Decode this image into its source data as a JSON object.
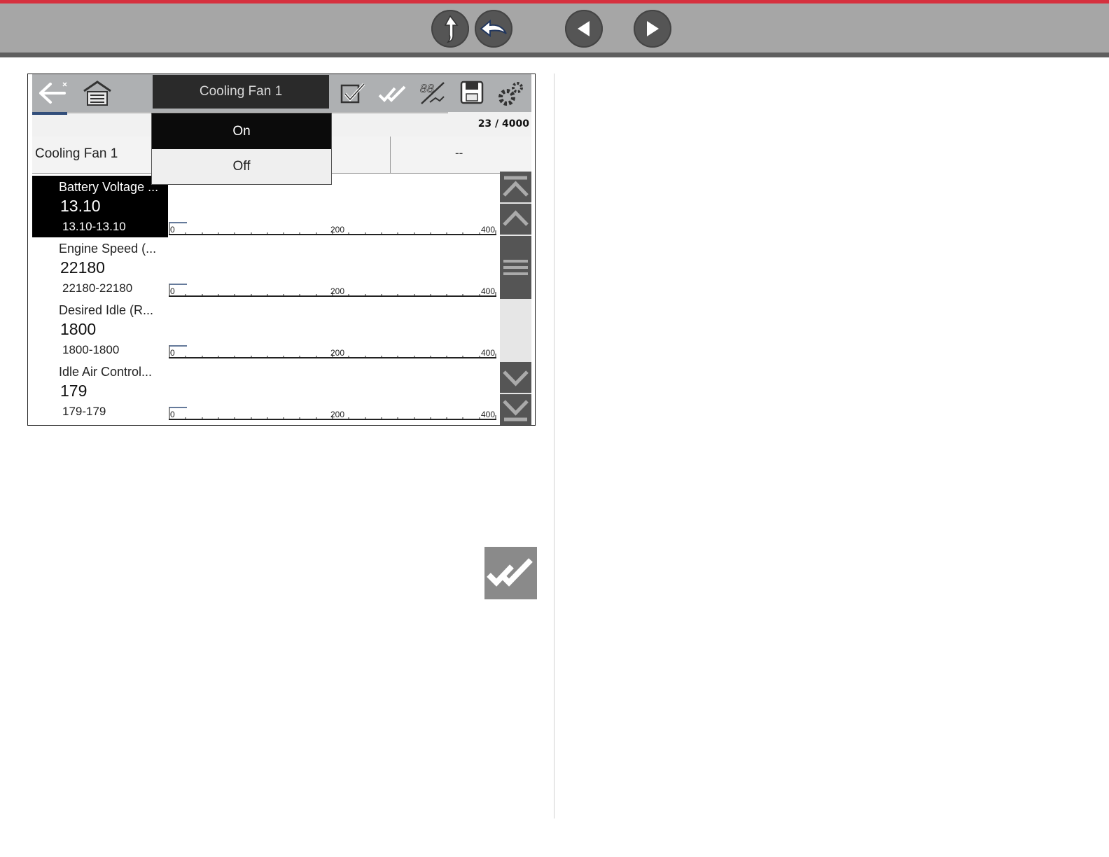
{
  "nav": {
    "buttons": [
      "up-icon",
      "back-arrow-icon",
      "previous-icon",
      "next-icon"
    ]
  },
  "toolbar": {
    "title": "Cooling Fan 1",
    "icons": [
      "back-icon",
      "home-icon",
      "check-icon",
      "check-all-icon",
      "pid-icon",
      "save-icon",
      "settings-icon"
    ]
  },
  "progress": {
    "counter": "23 / 4000",
    "fraction": 0.00575
  },
  "pid": {
    "name": "Cooling Fan 1",
    "value": "--"
  },
  "dropdown": {
    "options": [
      "On",
      "Off"
    ],
    "selected": "On"
  },
  "data_list": [
    {
      "name": "Battery Voltage ...",
      "value": "13.10",
      "range": "13.10-13.10",
      "selected": true
    },
    {
      "name": "Engine Speed (...",
      "value": "22180",
      "range": "22180-22180",
      "selected": false
    },
    {
      "name": "Desired Idle (R...",
      "value": "1800",
      "range": "1800-1800",
      "selected": false
    },
    {
      "name": "Idle Air Control...",
      "value": "179",
      "range": "179-179",
      "selected": false
    }
  ],
  "graph_axis": [
    "0",
    "200",
    "400"
  ],
  "colors": {
    "accent_red": "#d6303e",
    "nav_gray": "#a6a6a6",
    "toolbar_gray": "#aeb0b2",
    "progress_blue": "#324e7a"
  }
}
